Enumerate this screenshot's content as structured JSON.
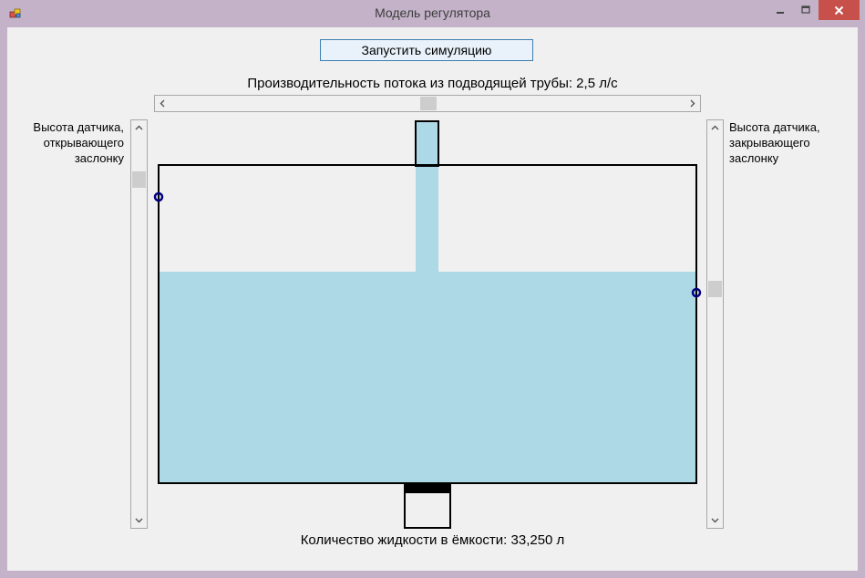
{
  "window": {
    "title": "Модель регулятора",
    "icon": "app-form-icon",
    "controls": [
      "minimize-icon",
      "maximize-icon",
      "close-icon"
    ],
    "close_color": "#c7504b"
  },
  "toolbar": {
    "start_label": "Запустить симуляцию"
  },
  "flow": {
    "label": "Производительность потока из подводящей трубы: 2,5 л/с",
    "slider_fraction": 0.5
  },
  "sensors": {
    "open_label": "Высота датчика, открывающего заслонку",
    "close_label": "Высота датчика, закрывающего заслонку",
    "open_slider_fraction": 0.12,
    "close_slider_fraction": 0.4
  },
  "tank": {
    "fill_fraction": 0.665,
    "water_color": "#add8e6",
    "sensor_color": "#000080"
  },
  "volume": {
    "label": "Количество жидкости в ёмкости: 33,250 л"
  }
}
